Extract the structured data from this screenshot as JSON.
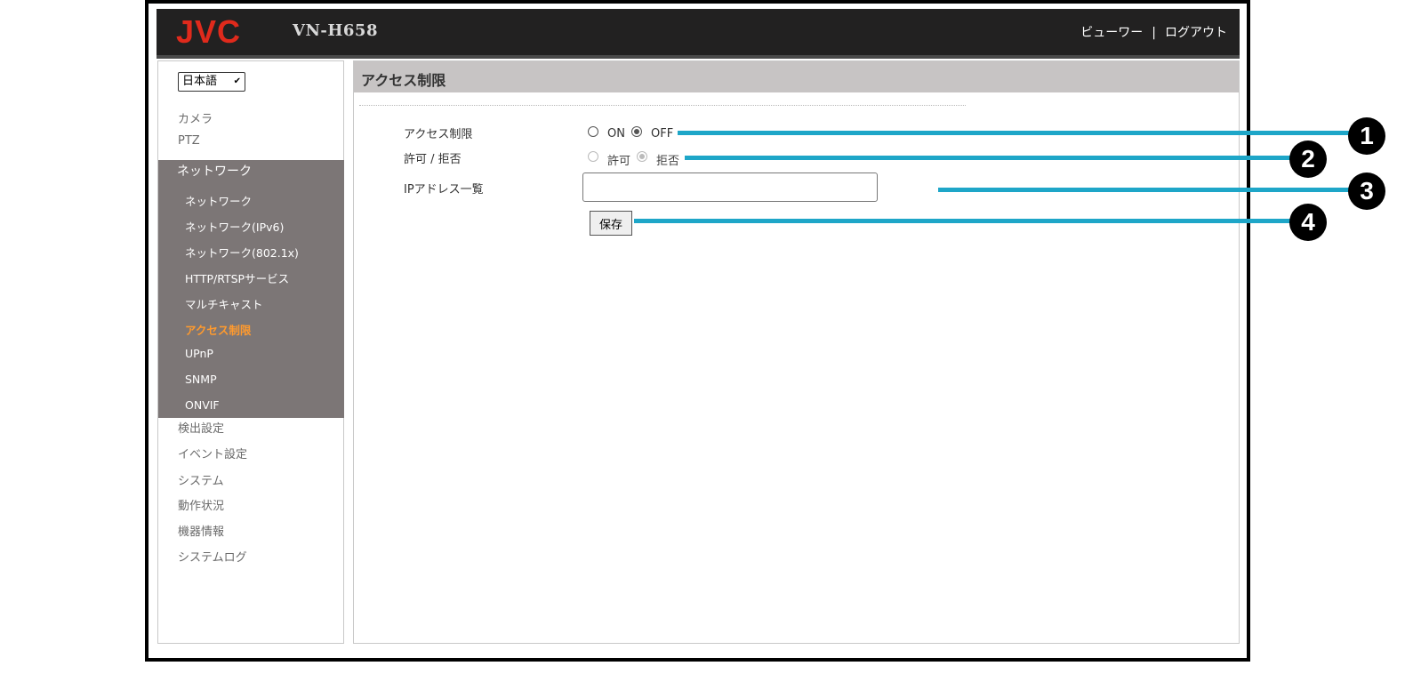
{
  "header": {
    "brand": "JVC",
    "model": "VN-H658",
    "nav": {
      "viewer": "ビューワー",
      "separator": "|",
      "logout": "ログアウト"
    }
  },
  "sidebar": {
    "language": "日本語",
    "top_items": [
      "カメラ",
      "PTZ"
    ],
    "network_group": {
      "title": "ネットワーク",
      "items": [
        "ネットワーク",
        "ネットワーク(IPv6)",
        "ネットワーク(802.1x)",
        "HTTP/RTSPサービス",
        "マルチキャスト",
        "アクセス制限",
        "UPnP",
        "SNMP",
        "ONVIF"
      ],
      "active_index": 5
    },
    "bottom_items": [
      "検出設定",
      "イベント設定",
      "システム",
      "動作状況",
      "機器情報",
      "システムログ"
    ]
  },
  "main": {
    "title": "アクセス制限",
    "access_restriction": {
      "label": "アクセス制限",
      "on": "ON",
      "off": "OFF",
      "selected": "OFF"
    },
    "permit_deny": {
      "label": "許可 / 拒否",
      "permit": "許可",
      "deny": "拒否",
      "selected": "拒否",
      "disabled": true
    },
    "ip_list": {
      "label": "IPアドレス一覧",
      "value": ""
    },
    "save_label": "保存"
  },
  "callouts": [
    "1",
    "2",
    "3",
    "4"
  ],
  "colors": {
    "header_bg": "#222121",
    "brand_red": "#e02a1c",
    "sidebar_group_bg": "#7c7676",
    "active_item": "#ff9a2e",
    "callout_line": "#1ea6c8",
    "title_bar": "#c7c4c4"
  }
}
